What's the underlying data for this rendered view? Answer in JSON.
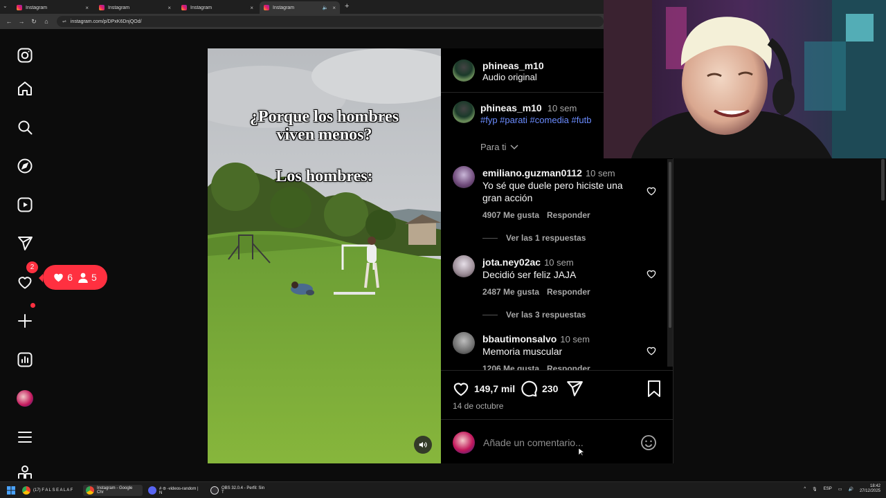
{
  "browser": {
    "tabs": [
      {
        "title": "Instagram",
        "active": false
      },
      {
        "title": "Instagram",
        "active": false
      },
      {
        "title": "Instagram",
        "active": false
      },
      {
        "title": "Instagram",
        "active": true
      }
    ],
    "url": "instagram.com/p/DPxK6DnjQOd/"
  },
  "sidebar": {
    "messages_badge": "2",
    "notifications_popup": {
      "likes": "6",
      "follows": "5"
    },
    "items": [
      "instagram-logo",
      "home-icon",
      "search-icon",
      "explore-icon",
      "reels-icon",
      "messages-icon",
      "notifications-icon",
      "create-icon",
      "dashboard-icon",
      "profile-avatar",
      "menu-icon",
      "apps-icon"
    ]
  },
  "video": {
    "caption_line1": "¿Porque los hombres",
    "caption_line2": "viven menos?",
    "caption_line3": "Los hombres:"
  },
  "post": {
    "author": "phineas_m10",
    "audio": "Audio original",
    "caption_author": "phineas_m10",
    "caption_time": "10 sem",
    "hashtags": "#fyp #parati #comedia #futb",
    "sort_label": "Para ti",
    "likes": "149,7 mil",
    "comments_count": "230",
    "date": "14 de octubre",
    "comment_placeholder": "Añade un comentario..."
  },
  "comments": [
    {
      "user": "emiliano.guzman0112",
      "time": "10 sem",
      "text_line1": "Yo sé que duele pero hiciste una",
      "text_line2": "gran acción",
      "likes": "4907 Me gusta",
      "reply": "Responder",
      "view_replies": "Ver las 1 respuestas"
    },
    {
      "user": "jota.ney02ac",
      "time": "10 sem",
      "text_line1": "Decidió ser feliz JAJA",
      "likes": "2487 Me gusta",
      "reply": "Responder",
      "view_replies": "Ver las 3 respuestas"
    },
    {
      "user": "bbautimonsalvo",
      "time": "10 sem",
      "text_line1": "Memoria muscular",
      "likes": "1206 Me gusta",
      "reply": "Responder"
    }
  ],
  "taskbar": {
    "items": [
      "(17) F A L S E A L A F",
      "Instagram - Google Chr",
      "# ⊜ -videos-random | N",
      "OBS 32.0.4 - Perfil: Sin T"
    ],
    "lang": "ESP",
    "time": "18:42",
    "date": "27/12/2025"
  },
  "colors": {
    "accent_red": "#ff3040",
    "hashtag_blue": "#6b8cff",
    "panel_bg": "#000000"
  }
}
